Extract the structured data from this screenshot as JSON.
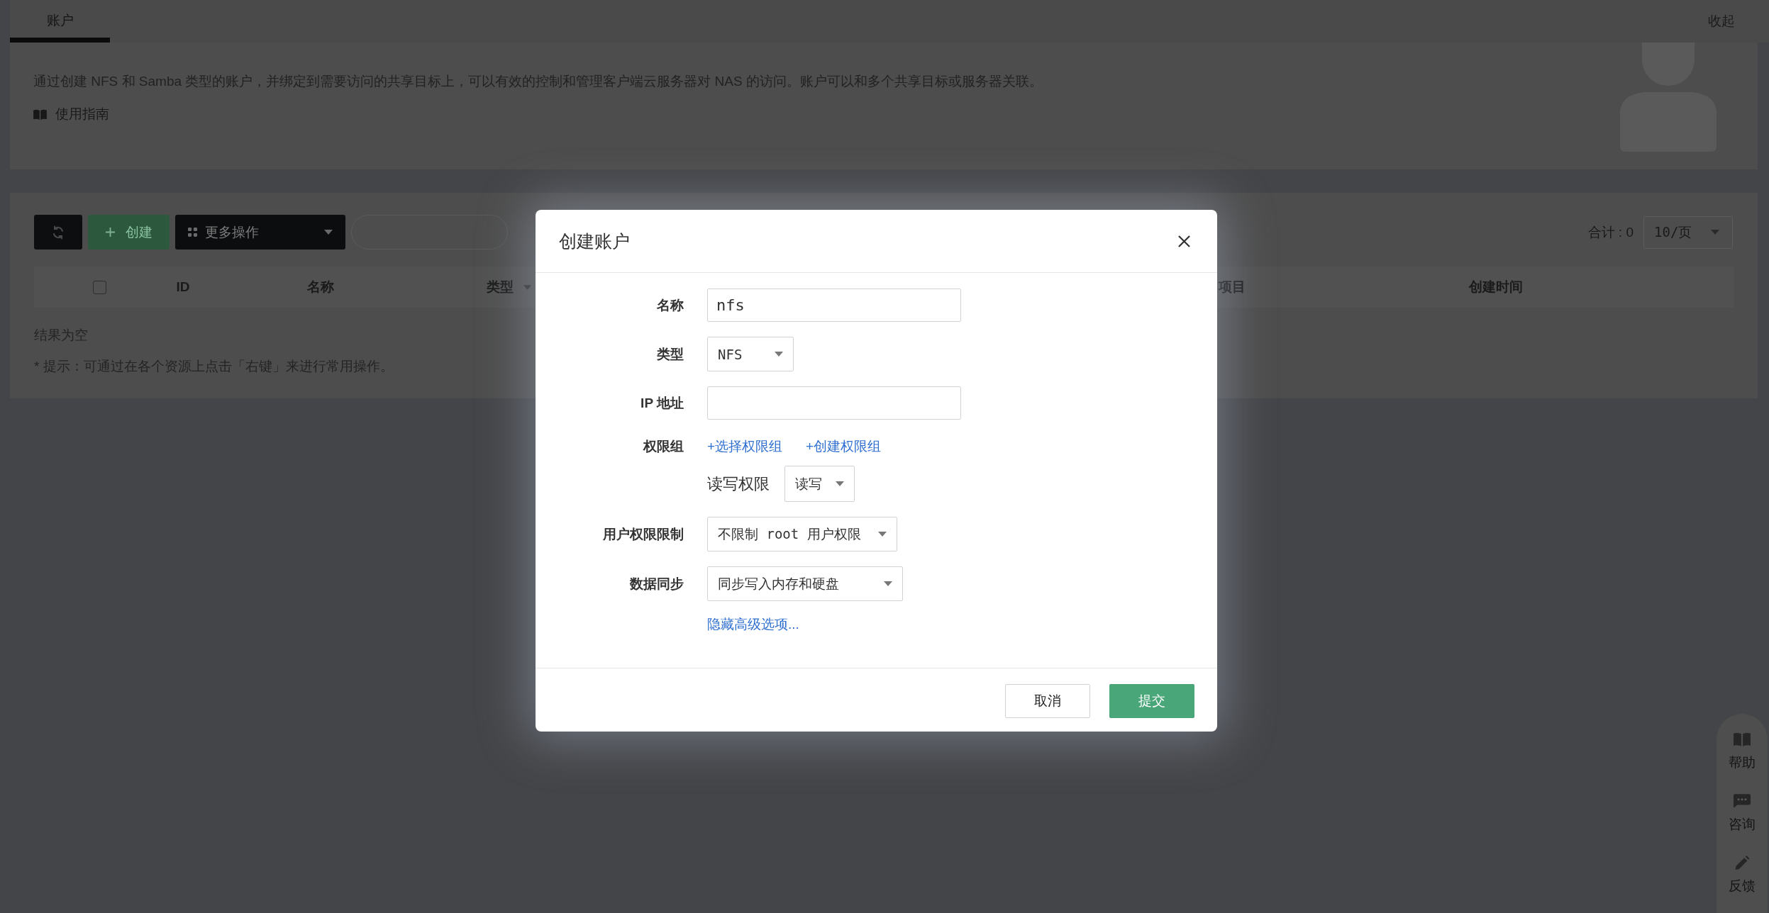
{
  "tabs": [
    {
      "label": "账户",
      "selected": true
    }
  ],
  "collapse_button": "收起",
  "intro": {
    "description": "通过创建 NFS 和 Samba 类型的账户，并绑定到需要访问的共享目标上，可以有效的控制和管理客户端云服务器对 NAS 的访问。账户可以和多个共享目标或服务器关联。",
    "guide_link": "使用指南"
  },
  "toolbar": {
    "create_button": "创建",
    "more_button": "更多操作",
    "total": "合计 : 0",
    "page_size": "10/页"
  },
  "table": {
    "select_all": {
      "checked": false
    },
    "columns": [
      {
        "label": "ID",
        "filter": false
      },
      {
        "label": "名称",
        "filter": false
      },
      {
        "label": "类型",
        "filter": true
      },
      {
        "label": "项目",
        "filter": false
      },
      {
        "label": "创建时间",
        "filter": false
      }
    ],
    "empty_text": "结果为空",
    "hint": "* 提示：可通过在各个资源上点击「右键」来进行常用操作。"
  },
  "dialog": {
    "title": "创建账户",
    "fields": [
      {
        "kind": "input",
        "label": "名称",
        "value": "nfs"
      },
      {
        "kind": "select",
        "label": "类型",
        "value": "NFS"
      },
      {
        "kind": "input",
        "label": "IP 地址"
      },
      {
        "kind": "permission",
        "label": "权限组",
        "links": [
          "+选择权限组",
          "+创建权限组"
        ],
        "sub_label": "读写权限",
        "sub_value": "读写"
      },
      {
        "kind": "select",
        "label": "用户权限限制",
        "value": "不限制 root 用户权限"
      },
      {
        "kind": "select",
        "label": "数据同步",
        "value": "同步写入内存和硬盘"
      }
    ],
    "advanced_link": "隐藏高级选项...",
    "buttons": [
      {
        "label": "取消",
        "kind": "secondary"
      },
      {
        "label": "提交",
        "kind": "primary"
      }
    ]
  },
  "help_panel": {
    "items": [
      {
        "label": "帮助"
      },
      {
        "label": "咨询"
      },
      {
        "label": "反馈"
      }
    ]
  }
}
